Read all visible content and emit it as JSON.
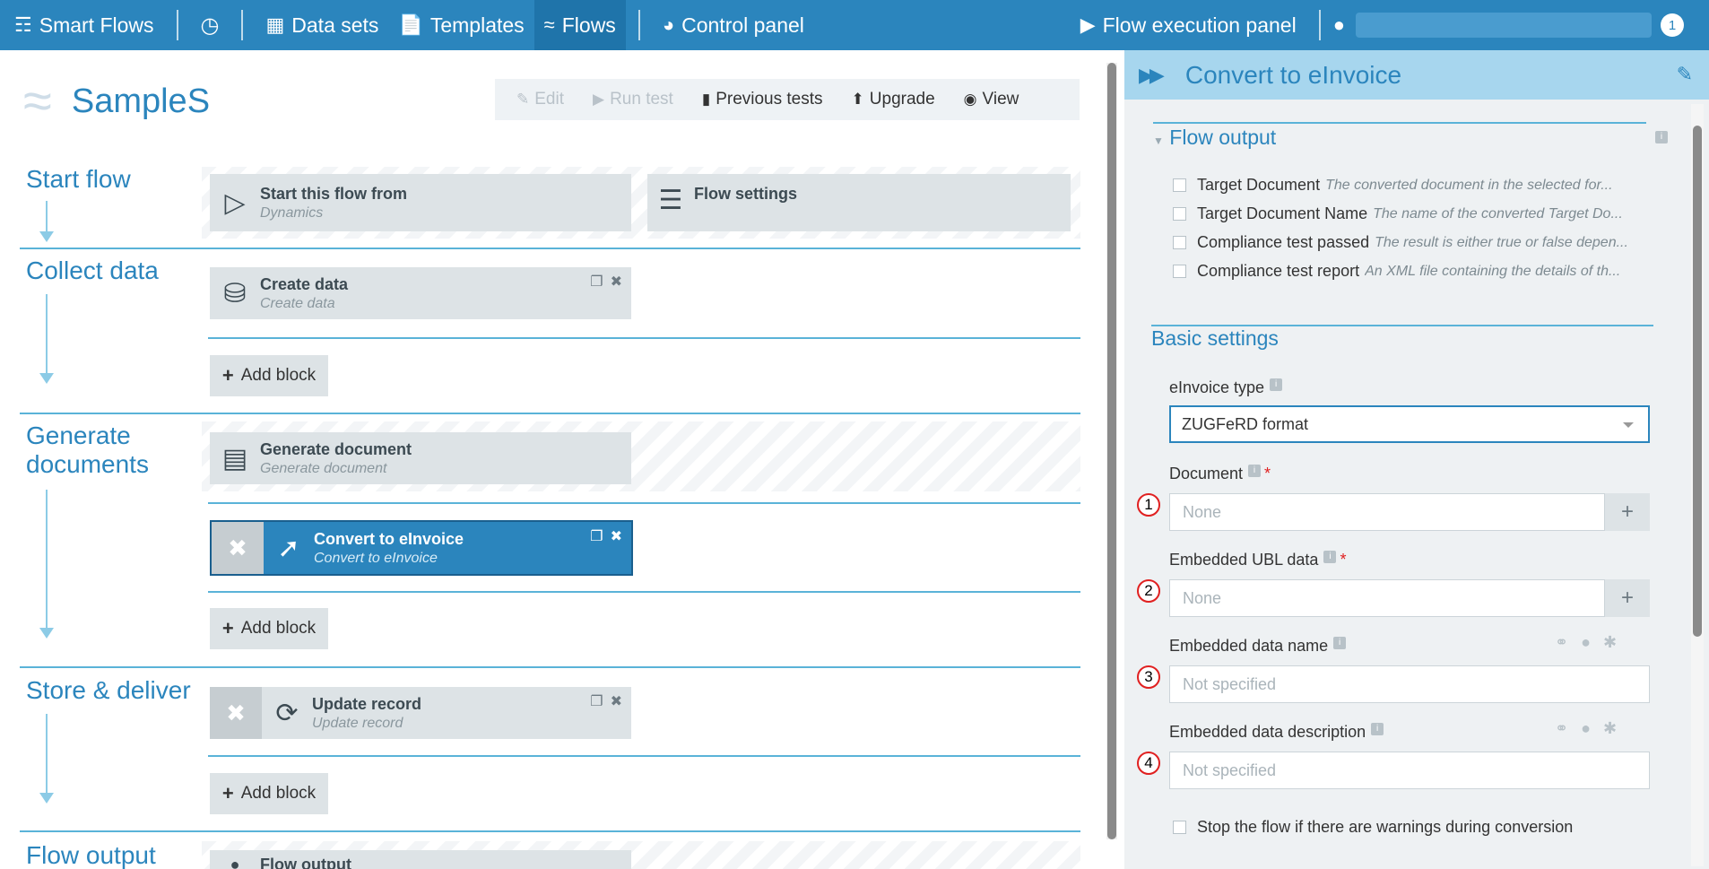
{
  "topbar": {
    "app_name": "Smart Flows",
    "nav": [
      {
        "label": "Data sets",
        "icon": "data-sets-icon"
      },
      {
        "label": "Templates",
        "icon": "template-icon"
      },
      {
        "label": "Flows",
        "icon": "flows-icon",
        "active": true
      },
      {
        "label": "Control panel",
        "icon": "gauge-icon"
      }
    ],
    "execution_panel": "Flow execution panel",
    "notification_count": "1"
  },
  "flow": {
    "title": "SampleS",
    "toolbar": {
      "edit": "Edit",
      "run_test": "Run test",
      "previous_tests": "Previous tests",
      "upgrade": "Upgrade",
      "view": "View"
    }
  },
  "sections": {
    "start": {
      "title": "Start flow",
      "start_block": {
        "name": "Start this flow from",
        "sub": "Dynamics"
      },
      "settings_block": {
        "name": "Flow settings"
      }
    },
    "collect": {
      "title": "Collect data",
      "block": {
        "name": "Create data",
        "sub": "Create data"
      },
      "add": "Add block"
    },
    "generate": {
      "title_line1": "Generate",
      "title_line2": "documents",
      "block1": {
        "name": "Generate document",
        "sub": "Generate document"
      },
      "block2": {
        "name": "Convert to eInvoice",
        "sub": "Convert to eInvoice"
      },
      "add": "Add block"
    },
    "store": {
      "title": "Store & deliver",
      "block": {
        "name": "Update record",
        "sub": "Update record"
      },
      "add": "Add block"
    },
    "output": {
      "title": "Flow output",
      "block": {
        "name": "Flow output"
      }
    }
  },
  "panel": {
    "title": "Convert to eInvoice",
    "flow_output": {
      "title": "Flow output",
      "items": [
        {
          "label": "Target Document",
          "desc": "The converted document in the selected for..."
        },
        {
          "label": "Target Document Name",
          "desc": "The name of the converted Target Do..."
        },
        {
          "label": "Compliance test passed",
          "desc": "The result is either true or false depen..."
        },
        {
          "label": "Compliance test report",
          "desc": "An XML file containing the details of th..."
        }
      ]
    },
    "basic_settings": {
      "title": "Basic settings",
      "einvoice_type_label": "eInvoice type",
      "einvoice_type_value": "ZUGFeRD format",
      "document_label": "Document",
      "document_value": "None",
      "ubl_label": "Embedded UBL data",
      "ubl_value": "None",
      "name_label": "Embedded data name",
      "name_placeholder": "Not specified",
      "desc_label": "Embedded data description",
      "desc_placeholder": "Not specified",
      "stop_label": "Stop the flow if there are warnings during conversion",
      "markers": [
        "1",
        "2",
        "3",
        "4"
      ]
    }
  },
  "colors": {
    "accent": "#2b85bd",
    "panel_header": "#a7d6ee",
    "required": "#e02020"
  }
}
